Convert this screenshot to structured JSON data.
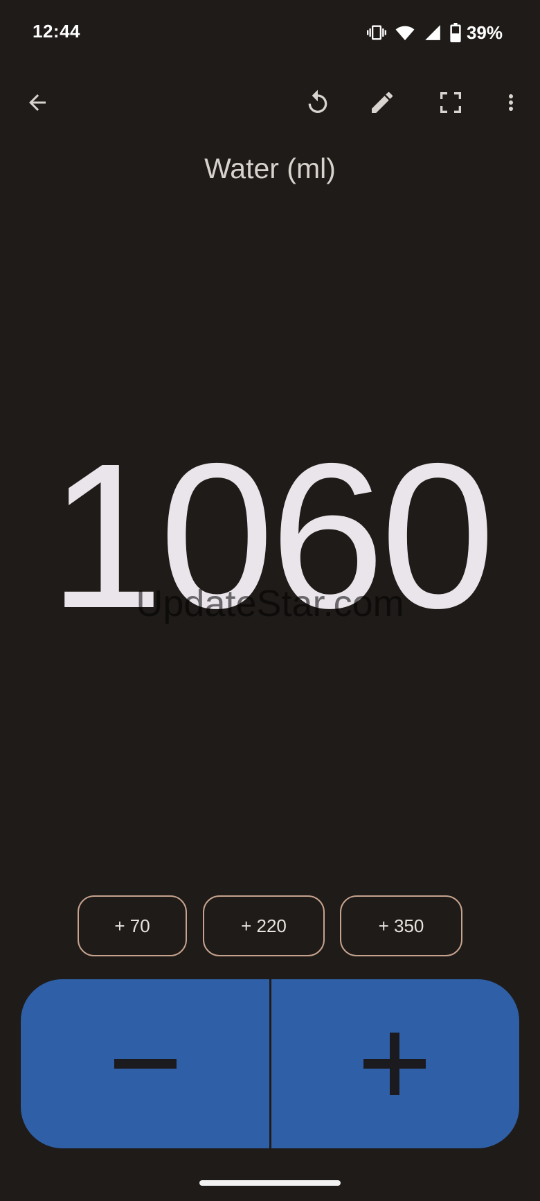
{
  "status_bar": {
    "time": "12:44",
    "battery_percent": "39%",
    "icons": [
      "vibrate-icon",
      "wifi-icon",
      "cell-signal-icon",
      "battery-icon"
    ]
  },
  "toolbar": {
    "icons": [
      "back-arrow-icon",
      "reset-icon",
      "edit-pencil-icon",
      "fullscreen-icon",
      "more-vert-icon"
    ]
  },
  "counter": {
    "title": "Water (ml)",
    "value": "1060"
  },
  "watermark": "UpdateStar.com",
  "quick_add": [
    {
      "label": "+ 70"
    },
    {
      "label": "+ 220"
    },
    {
      "label": "+ 350"
    }
  ],
  "stepper": {
    "decrement_icon": "minus-icon",
    "increment_icon": "plus-icon"
  },
  "colors": {
    "background": "#1f1b18",
    "accent": "#2f5fa6",
    "chip_border": "#c6a38e"
  }
}
